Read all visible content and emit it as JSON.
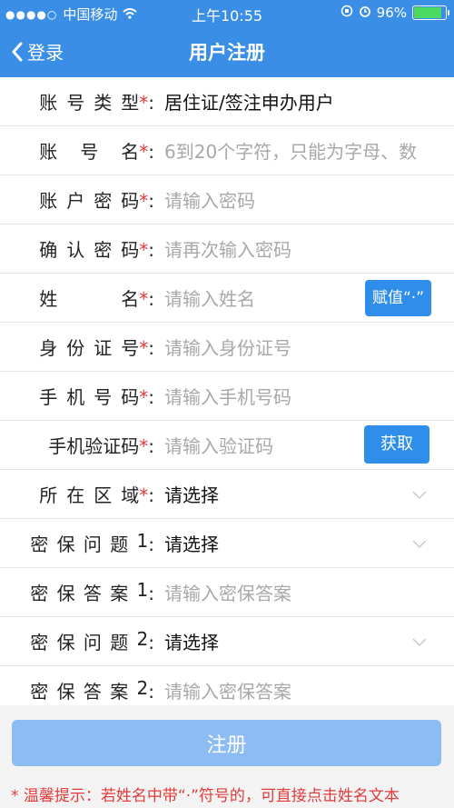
{
  "status_bar": {
    "signal_dots": "●●●●○",
    "carrier": "中国移动",
    "time": "上午10:55",
    "battery_percent": "96%",
    "battery_level": 0.96
  },
  "nav": {
    "back_label": "登录",
    "title": "用户注册"
  },
  "form": {
    "account_type": {
      "label": "账号类型",
      "required": "*",
      "colon": ":",
      "value": "居住证/签注申办用户"
    },
    "account_name": {
      "label": "账号名",
      "required": "*",
      "colon": ":",
      "placeholder": "6到20个字符，只能为字母、数"
    },
    "account_password": {
      "label": "账户密码",
      "required": "*",
      "colon": ":",
      "placeholder": "请输入密码"
    },
    "confirm_password": {
      "label": "确认密码",
      "required": "*",
      "colon": ":",
      "placeholder": "请再次输入密码"
    },
    "name": {
      "label": "姓名",
      "required": "*",
      "colon": ":",
      "placeholder": "请输入姓名",
      "button": "赋值“·”"
    },
    "id_number": {
      "label": "身份证号",
      "required": "*",
      "colon": ":",
      "placeholder": "请输入身份证号"
    },
    "phone": {
      "label": "手机号码",
      "required": "*",
      "colon": ":",
      "placeholder": "请输入手机号码"
    },
    "sms_code": {
      "label": "手机验证码",
      "required": "*",
      "colon": ":",
      "placeholder": "请输入验证码",
      "button": "获取"
    },
    "region": {
      "label": "所在区域",
      "required": "*",
      "colon": ":",
      "value": "请选择"
    },
    "question1": {
      "label": "密保问题1",
      "colon": ":",
      "value": "请选择"
    },
    "answer1": {
      "label": "密保答案1",
      "colon": ":",
      "placeholder": "请输入密保答案"
    },
    "question2": {
      "label": "密保问题2",
      "colon": ":",
      "value": "请选择"
    },
    "answer2": {
      "label": "密保答案2",
      "colon": ":",
      "placeholder": "请输入密保答案"
    }
  },
  "submit_label": "注册",
  "tip": "* 温馨提示：若姓名中带“·”符号的，可直接点击姓名文本",
  "colors": {
    "primary": "#3a8ee6",
    "submit_disabled": "#8cbcf3",
    "required": "#e23b3b",
    "placeholder": "#a8a8a8"
  }
}
